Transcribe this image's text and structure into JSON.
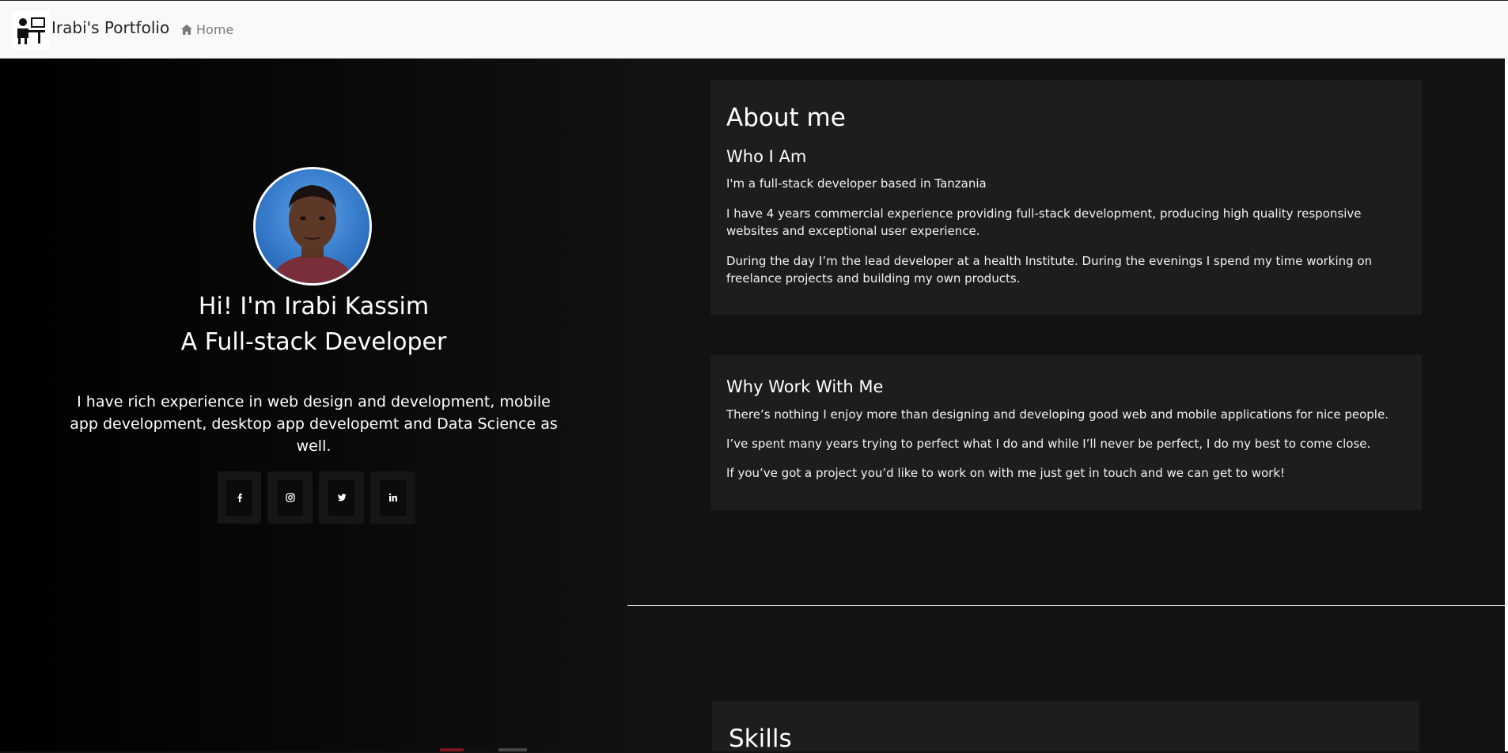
{
  "navbar": {
    "brand": "Irabi's Portfolio",
    "home_label": "Home"
  },
  "hero": {
    "greeting": "Hi! I'm Irabi Kassim",
    "role": "A Full-stack Developer",
    "description": "I have rich experience in web design and development, mobile app development, desktop app developemt and Data Science as well.",
    "socials": [
      "facebook-icon",
      "instagram-icon",
      "twitter-icon",
      "linkedin-icon"
    ]
  },
  "about": {
    "title": "About me",
    "who_title": "Who I Am",
    "paragraphs": [
      "I'm a full-stack developer based in Tanzania",
      "I have 4 years commercial experience providing full-stack development, producing high quality responsive websites and exceptional user experience.",
      "During the day I’m the lead developer at a health Institute. During the evenings I spend my time working on freelance projects and building my own products."
    ]
  },
  "why": {
    "title": "Why Work With Me",
    "paragraphs": [
      "There’s nothing I enjoy more than designing and developing good web and mobile applications for nice people.",
      "I’ve spent many years trying to perfect what I do and while I’ll never be perfect, I do my best to come close.",
      "If you’ve got a project you’d like to work on with me just get in touch and we can get to work!"
    ]
  },
  "skills": {
    "title": "Skills"
  },
  "colors": {
    "background": "#121212",
    "card": "#1d1d1d",
    "navbar": "#f8f9fa"
  }
}
